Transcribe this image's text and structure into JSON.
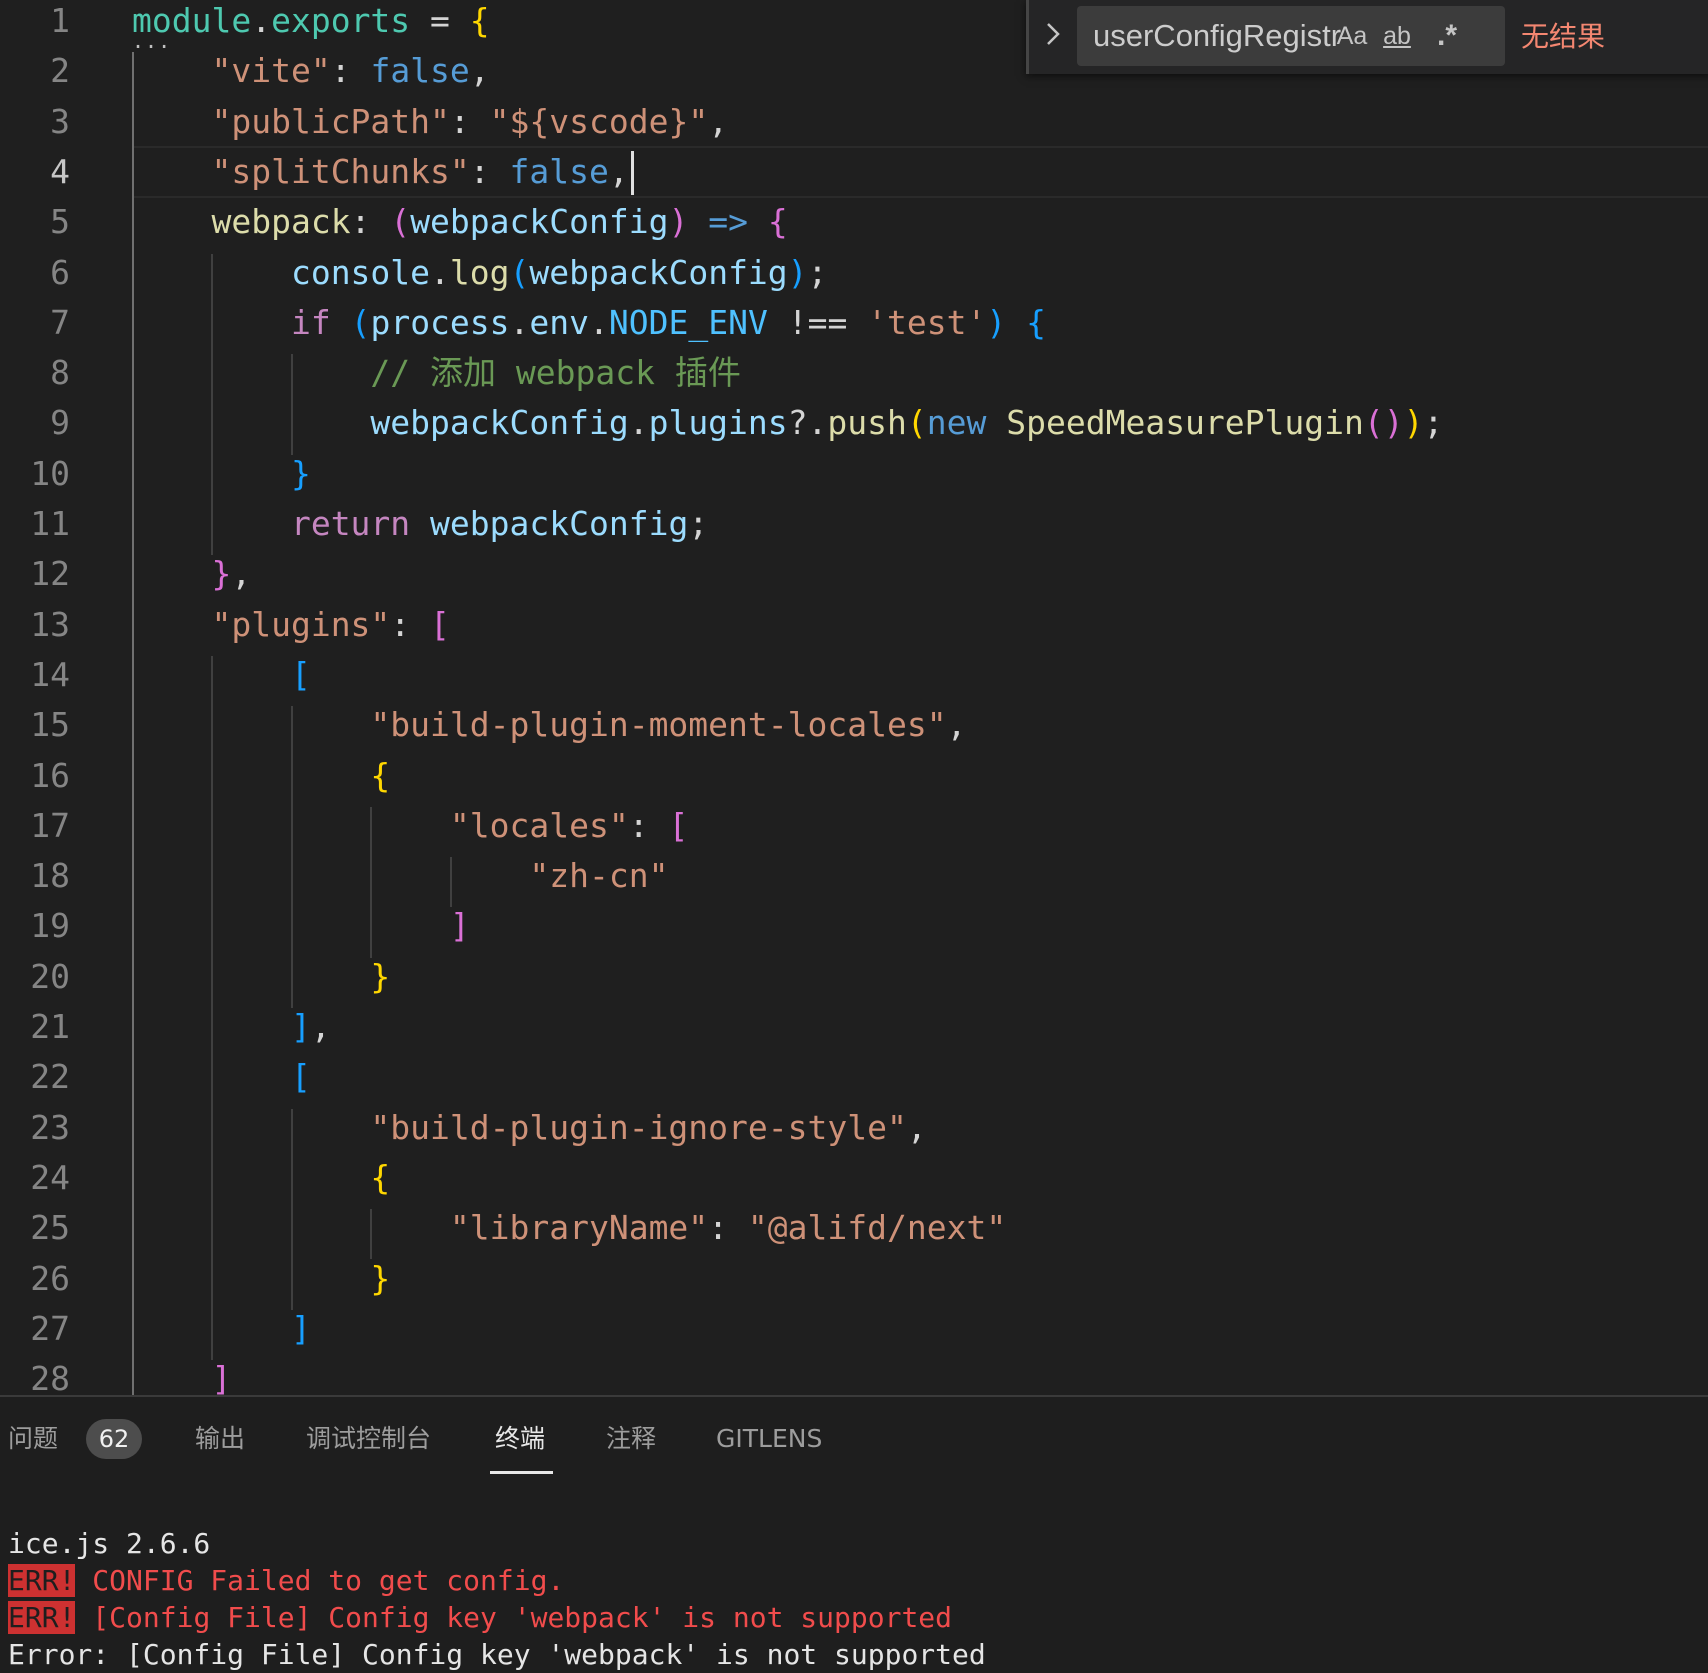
{
  "editor": {
    "line_numbers": [
      "1",
      "2",
      "3",
      "4",
      "5",
      "6",
      "7",
      "8",
      "9",
      "10",
      "11",
      "12",
      "13",
      "14",
      "15",
      "16",
      "17",
      "18",
      "19",
      "20",
      "21",
      "22",
      "23",
      "24",
      "25",
      "26",
      "27",
      "28"
    ],
    "active_line": 4,
    "fold_marker": "...",
    "lines": [
      [
        {
          "c": "t-type",
          "t": "module"
        },
        {
          "c": "t-punc",
          "t": "."
        },
        {
          "c": "t-type",
          "t": "exports"
        },
        {
          "c": "t-punc",
          "t": " = "
        },
        {
          "c": "b1",
          "t": "{"
        }
      ],
      [
        {
          "c": "t-punc",
          "t": "    "
        },
        {
          "c": "t-str",
          "t": "\"vite\""
        },
        {
          "c": "t-punc",
          "t": ": "
        },
        {
          "c": "t-kw",
          "t": "false"
        },
        {
          "c": "t-punc",
          "t": ","
        }
      ],
      [
        {
          "c": "t-punc",
          "t": "    "
        },
        {
          "c": "t-str",
          "t": "\"publicPath\""
        },
        {
          "c": "t-punc",
          "t": ": "
        },
        {
          "c": "t-str",
          "t": "\"${vscode}\""
        },
        {
          "c": "t-punc",
          "t": ","
        }
      ],
      [
        {
          "c": "t-punc",
          "t": "    "
        },
        {
          "c": "t-str",
          "t": "\"splitChunks\""
        },
        {
          "c": "t-punc",
          "t": ": "
        },
        {
          "c": "t-kw",
          "t": "false"
        },
        {
          "c": "t-punc",
          "t": ","
        }
      ],
      [
        {
          "c": "t-punc",
          "t": "    "
        },
        {
          "c": "t-prop",
          "t": "webpack"
        },
        {
          "c": "t-punc",
          "t": ": "
        },
        {
          "c": "b2",
          "t": "("
        },
        {
          "c": "t-var",
          "t": "webpackConfig"
        },
        {
          "c": "b2",
          "t": ")"
        },
        {
          "c": "t-punc",
          "t": " "
        },
        {
          "c": "t-kw",
          "t": "=>"
        },
        {
          "c": "t-punc",
          "t": " "
        },
        {
          "c": "b2",
          "t": "{"
        }
      ],
      [
        {
          "c": "t-punc",
          "t": "        "
        },
        {
          "c": "t-var",
          "t": "console"
        },
        {
          "c": "t-punc",
          "t": "."
        },
        {
          "c": "t-fn",
          "t": "log"
        },
        {
          "c": "b3",
          "t": "("
        },
        {
          "c": "t-var",
          "t": "webpackConfig"
        },
        {
          "c": "b3",
          "t": ")"
        },
        {
          "c": "t-punc",
          "t": ";"
        }
      ],
      [
        {
          "c": "t-punc",
          "t": "        "
        },
        {
          "c": "t-ctrl",
          "t": "if"
        },
        {
          "c": "t-punc",
          "t": " "
        },
        {
          "c": "b3",
          "t": "("
        },
        {
          "c": "t-var",
          "t": "process"
        },
        {
          "c": "t-punc",
          "t": "."
        },
        {
          "c": "t-var",
          "t": "env"
        },
        {
          "c": "t-punc",
          "t": "."
        },
        {
          "c": "t-const",
          "t": "NODE_ENV"
        },
        {
          "c": "t-punc",
          "t": " !== "
        },
        {
          "c": "t-str",
          "t": "'test'"
        },
        {
          "c": "b3",
          "t": ")"
        },
        {
          "c": "t-punc",
          "t": " "
        },
        {
          "c": "b3",
          "t": "{"
        }
      ],
      [
        {
          "c": "t-punc",
          "t": "            "
        },
        {
          "c": "t-cmt",
          "t": "// 添加 webpack 插件"
        }
      ],
      [
        {
          "c": "t-punc",
          "t": "            "
        },
        {
          "c": "t-var",
          "t": "webpackConfig"
        },
        {
          "c": "t-punc",
          "t": "."
        },
        {
          "c": "t-var",
          "t": "plugins"
        },
        {
          "c": "t-punc",
          "t": "?."
        },
        {
          "c": "t-fn",
          "t": "push"
        },
        {
          "c": "b1",
          "t": "("
        },
        {
          "c": "t-kw",
          "t": "new"
        },
        {
          "c": "t-punc",
          "t": " "
        },
        {
          "c": "t-fn",
          "t": "SpeedMeasurePlugin"
        },
        {
          "c": "b2",
          "t": "()"
        },
        {
          "c": "b1",
          "t": ")"
        },
        {
          "c": "t-punc",
          "t": ";"
        }
      ],
      [
        {
          "c": "t-punc",
          "t": "        "
        },
        {
          "c": "b3",
          "t": "}"
        }
      ],
      [
        {
          "c": "t-punc",
          "t": "        "
        },
        {
          "c": "t-ctrl",
          "t": "return"
        },
        {
          "c": "t-punc",
          "t": " "
        },
        {
          "c": "t-var",
          "t": "webpackConfig"
        },
        {
          "c": "t-punc",
          "t": ";"
        }
      ],
      [
        {
          "c": "t-punc",
          "t": "    "
        },
        {
          "c": "b2",
          "t": "}"
        },
        {
          "c": "t-punc",
          "t": ","
        }
      ],
      [
        {
          "c": "t-punc",
          "t": "    "
        },
        {
          "c": "t-str",
          "t": "\"plugins\""
        },
        {
          "c": "t-punc",
          "t": ": "
        },
        {
          "c": "b2",
          "t": "["
        }
      ],
      [
        {
          "c": "t-punc",
          "t": "        "
        },
        {
          "c": "b3",
          "t": "["
        }
      ],
      [
        {
          "c": "t-punc",
          "t": "            "
        },
        {
          "c": "t-str",
          "t": "\"build-plugin-moment-locales\""
        },
        {
          "c": "t-punc",
          "t": ","
        }
      ],
      [
        {
          "c": "t-punc",
          "t": "            "
        },
        {
          "c": "b1",
          "t": "{"
        }
      ],
      [
        {
          "c": "t-punc",
          "t": "                "
        },
        {
          "c": "t-str",
          "t": "\"locales\""
        },
        {
          "c": "t-punc",
          "t": ": "
        },
        {
          "c": "b2",
          "t": "["
        }
      ],
      [
        {
          "c": "t-punc",
          "t": "                    "
        },
        {
          "c": "t-str",
          "t": "\"zh-cn\""
        }
      ],
      [
        {
          "c": "t-punc",
          "t": "                "
        },
        {
          "c": "b2",
          "t": "]"
        }
      ],
      [
        {
          "c": "t-punc",
          "t": "            "
        },
        {
          "c": "b1",
          "t": "}"
        }
      ],
      [
        {
          "c": "t-punc",
          "t": "        "
        },
        {
          "c": "b3",
          "t": "]"
        },
        {
          "c": "t-punc",
          "t": ","
        }
      ],
      [
        {
          "c": "t-punc",
          "t": "        "
        },
        {
          "c": "b3",
          "t": "["
        }
      ],
      [
        {
          "c": "t-punc",
          "t": "            "
        },
        {
          "c": "t-str",
          "t": "\"build-plugin-ignore-style\""
        },
        {
          "c": "t-punc",
          "t": ","
        }
      ],
      [
        {
          "c": "t-punc",
          "t": "            "
        },
        {
          "c": "b1",
          "t": "{"
        }
      ],
      [
        {
          "c": "t-punc",
          "t": "                "
        },
        {
          "c": "t-str",
          "t": "\"libraryName\""
        },
        {
          "c": "t-punc",
          "t": ": "
        },
        {
          "c": "t-str",
          "t": "\"@alifd/next\""
        }
      ],
      [
        {
          "c": "t-punc",
          "t": "            "
        },
        {
          "c": "b1",
          "t": "}"
        }
      ],
      [
        {
          "c": "t-punc",
          "t": "        "
        },
        {
          "c": "b3",
          "t": "]"
        }
      ],
      [
        {
          "c": "t-punc",
          "t": "    "
        },
        {
          "c": "b2",
          "t": "]"
        }
      ]
    ]
  },
  "find_widget": {
    "toggle_icon": "chevron-right-icon",
    "query": "userConfigRegistr",
    "match_case_label": "Aa",
    "whole_word_label": "ab",
    "regex_label": ".*",
    "result_text": "无结果"
  },
  "panel": {
    "tabs": [
      {
        "label": "问题"
      },
      {
        "label": "输出"
      },
      {
        "label": "调试控制台"
      },
      {
        "label": "终端"
      },
      {
        "label": "注释"
      },
      {
        "label": "GITLENS"
      }
    ],
    "active_tab": "终端",
    "problems_count": "62",
    "terminal": {
      "line1": "ice.js 2.6.6",
      "err_tag": "ERR!",
      "err1": " CONFIG Failed to get config.",
      "err2": " [Config File] Config key 'webpack' is not supported",
      "line4": "Error: [Config File] Config key 'webpack' is not supported"
    }
  }
}
